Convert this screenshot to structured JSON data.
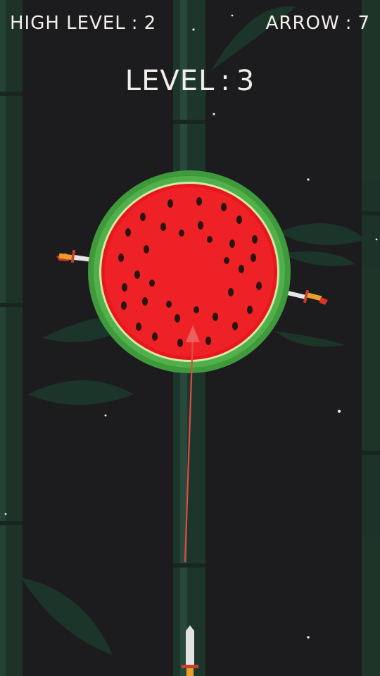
{
  "hud": {
    "high_level_label": "HIGH LEVEL",
    "high_level_value": "2",
    "arrow_label": "ARROW",
    "arrow_value": "7",
    "level_label": "LEVEL",
    "level_value": "3",
    "separator": ":"
  },
  "colors": {
    "background": "#1c1c1f",
    "bamboo": "#1f3a2e",
    "rind_dark": "#3f9b3c",
    "rind_light": "#cfe7a6",
    "flesh": "#e8171b",
    "seed": "#2a1410",
    "aim_line": "#e04a45",
    "hud_text": "#f2eee8"
  },
  "target": {
    "type": "watermelon-slice",
    "stuck_knives": 2
  },
  "player_knife": {
    "state": "ready"
  }
}
